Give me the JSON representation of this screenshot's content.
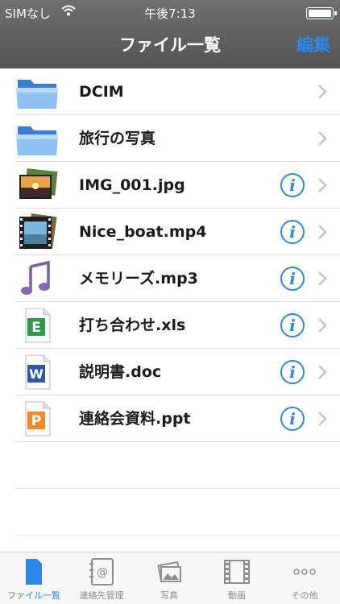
{
  "status": {
    "carrier": "SIMなし",
    "time": "午後7:13"
  },
  "nav": {
    "title": "ファイル一覧",
    "edit_label": "編集"
  },
  "files": [
    {
      "name": "DCIM",
      "icon": "folder-icon",
      "info": false
    },
    {
      "name": "旅行の写真",
      "icon": "folder-icon",
      "info": false
    },
    {
      "name": "IMG_001.jpg",
      "icon": "image-file-icon",
      "info": true
    },
    {
      "name": "Nice_boat.mp4",
      "icon": "video-file-icon",
      "info": true
    },
    {
      "name": "メモリーズ.mp3",
      "icon": "music-file-icon",
      "info": true
    },
    {
      "name": "打ち合わせ.xls",
      "icon": "excel-file-icon",
      "info": true
    },
    {
      "name": "説明書.doc",
      "icon": "word-file-icon",
      "info": true
    },
    {
      "name": "連絡会資料.ppt",
      "icon": "powerpoint-file-icon",
      "info": true
    }
  ],
  "info_glyph": "i",
  "tabs": [
    {
      "label": "ファイル一覧",
      "icon": "file-list-icon",
      "active": true
    },
    {
      "label": "連絡先管理",
      "icon": "contacts-icon",
      "active": false
    },
    {
      "label": "写真",
      "icon": "photos-icon",
      "active": false
    },
    {
      "label": "動画",
      "icon": "film-icon",
      "active": false
    },
    {
      "label": "その他",
      "icon": "more-icon",
      "active": false
    }
  ],
  "colors": {
    "accent": "#2a88ea",
    "navbar": "#5f5f5f"
  }
}
